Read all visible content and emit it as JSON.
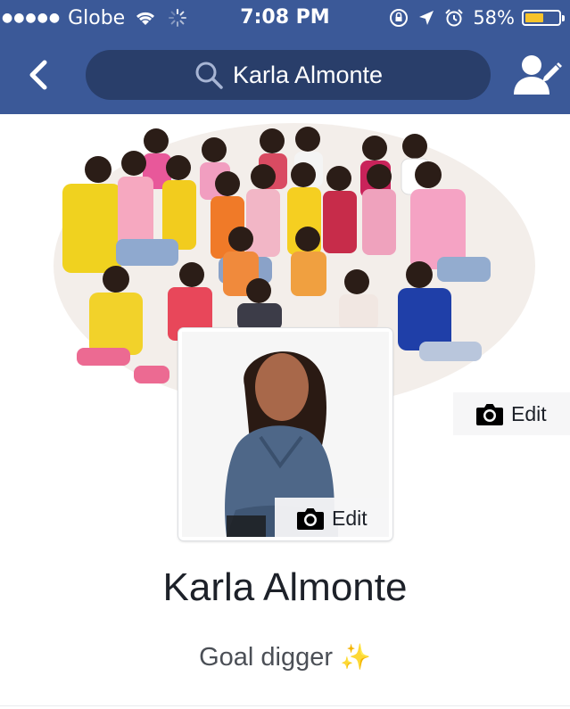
{
  "status_bar": {
    "signal_dots": "●●●●●",
    "carrier": "Globe",
    "time": "7:08 PM",
    "battery": "58%",
    "battery_level": 0.58,
    "battery_color": "#f7c32a"
  },
  "nav": {
    "search_query": "Karla Almonte",
    "header_color": "#3b5998",
    "search_bg": "#293e6a"
  },
  "cover": {
    "edit_label": "Edit"
  },
  "profile_photo": {
    "edit_label": "Edit"
  },
  "profile": {
    "name": "Karla Almonte",
    "bio": "Goal digger",
    "bio_emoji": "✨"
  }
}
